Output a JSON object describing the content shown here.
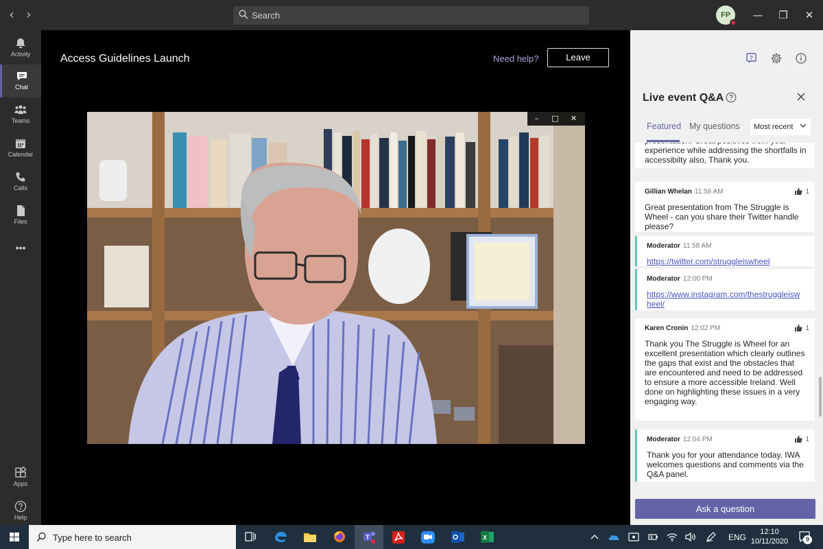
{
  "titlebar": {
    "search_placeholder": "Search",
    "avatar_initials": "FP"
  },
  "rail": {
    "items": [
      {
        "label": "Activity",
        "icon": "bell-icon"
      },
      {
        "label": "Chat",
        "icon": "chat-icon"
      },
      {
        "label": "Teams",
        "icon": "teams-icon"
      },
      {
        "label": "Calendar",
        "icon": "calendar-icon"
      },
      {
        "label": "Calls",
        "icon": "phone-icon"
      },
      {
        "label": "Files",
        "icon": "file-icon"
      }
    ],
    "more": "•••",
    "apps_label": "Apps",
    "help_label": "Help"
  },
  "stage": {
    "title": "Access Guidelines Launch",
    "need_help": "Need help?",
    "leave": "Leave"
  },
  "panel": {
    "title": "Live event Q&A",
    "tabs": [
      "Featured",
      "My questions"
    ],
    "sort": "Most recent",
    "cards": [
      {
        "type": "question",
        "author": "",
        "time": "",
        "likes": "",
        "body": "presentation. Great positives from your experience while addressing the shortfalls in accessibilty also, Thank you."
      },
      {
        "type": "question",
        "author": "Gillian Whelan",
        "time": "11:58 AM",
        "likes": "1",
        "body": "Great presentation from The Struggle is Wheel - can you share their Twitter handle please?"
      },
      {
        "type": "moderator",
        "author": "Moderator",
        "time": "11:58 AM",
        "likes": "",
        "link": "https://twitter.com/struggleiswheel"
      },
      {
        "type": "moderator",
        "author": "Moderator",
        "time": "12:00 PM",
        "likes": "",
        "link": "https://www.instagram.com/thestruggleiswheel/"
      },
      {
        "type": "question",
        "author": "Karen Cronin",
        "time": "12:02 PM",
        "likes": "1",
        "body": "Thank you The Struggle is Wheel for an excellent presentation which clearly outlines the gaps that exist and the obstacles that are encountered and need to be addressed to ensure a more accessible Ireland. Well done on highlighting these issues in a very engaging way."
      },
      {
        "type": "moderator",
        "author": "Moderator",
        "time": "12:04 PM",
        "likes": "1",
        "body": "Thank you for your attendance today. IWA welcomes questions and comments via the Q&A panel."
      }
    ],
    "ask_button": "Ask a question"
  },
  "taskbar": {
    "search_placeholder": "Type here to search",
    "language": "ENG",
    "time": "12:10",
    "date": "10/11/2020",
    "notification_count": "9"
  },
  "colors": {
    "accent": "#6264a7",
    "moderator_bar": "#5fc6b2",
    "rail": "#2d2c2c",
    "taskbar": "#1f2f3e"
  }
}
